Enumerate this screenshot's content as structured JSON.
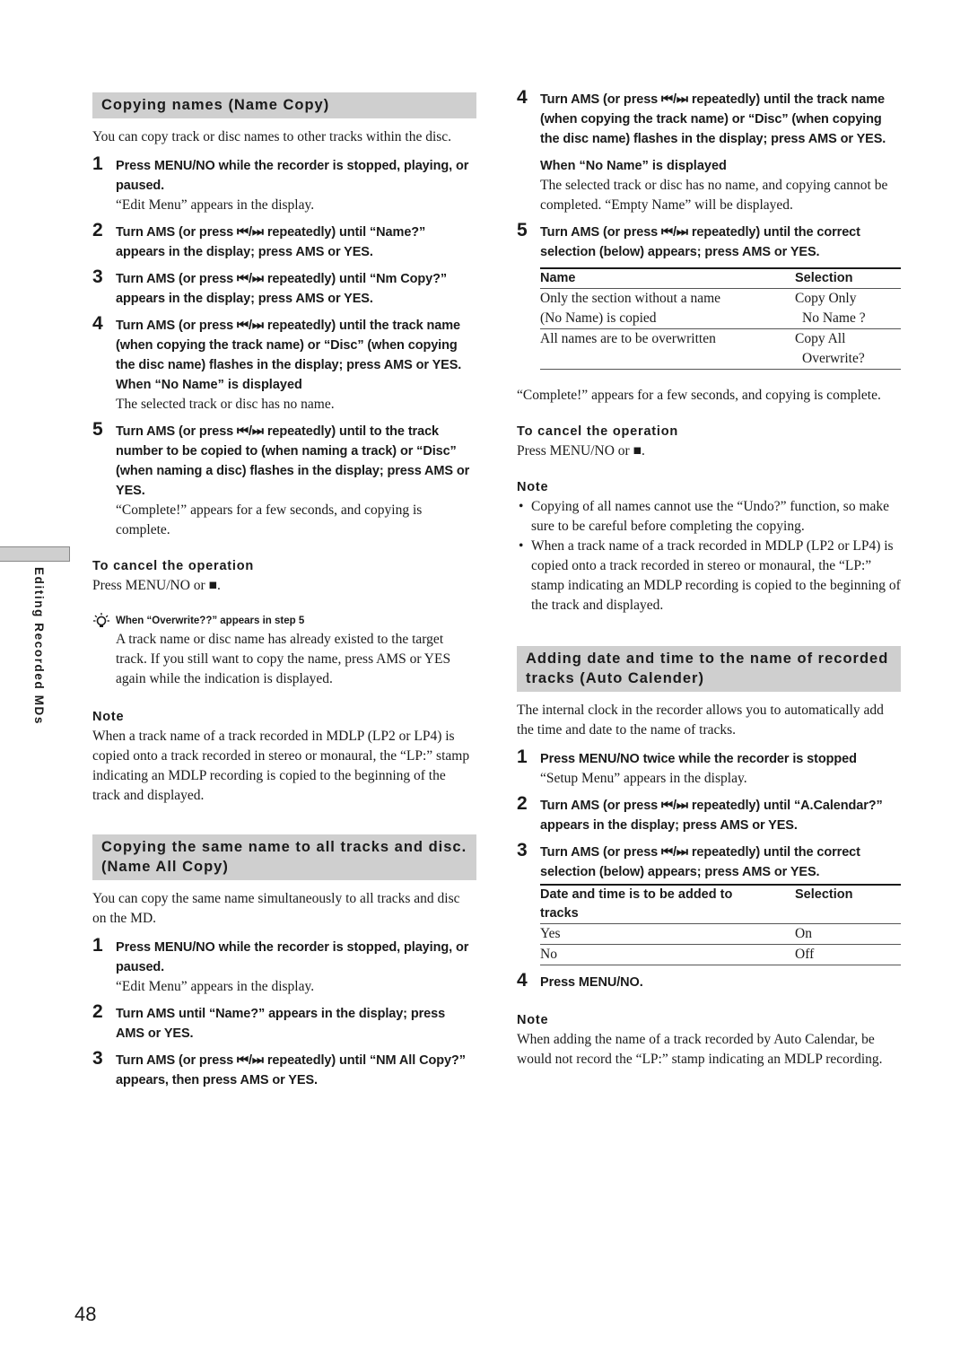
{
  "side_tab": {
    "label": "Editing Recorded MDs"
  },
  "page_number": "48",
  "left": {
    "section1": {
      "heading": "Copying names (Name Copy)",
      "intro": "You can copy track or disc names to other tracks within the disc.",
      "steps": [
        {
          "num": "1",
          "text": "Press MENU/NO while the recorder is stopped, playing, or paused.",
          "result": "“Edit Menu” appears in the display."
        },
        {
          "num": "2",
          "text": "Turn AMS (or press ⏮/⏭ repeatedly) until “Name?” appears in the display; press AMS or YES."
        },
        {
          "num": "3",
          "text": "Turn AMS (or press ⏮/⏭ repeatedly) until “Nm Copy?” appears in the display; press AMS or YES."
        },
        {
          "num": "4",
          "text": "Turn AMS (or press ⏮/⏭ repeatedly) until the track name (when copying the track name) or “Disc” (when copying the disc name) flashes in the display; press AMS or YES.",
          "sub_heading": "When “No Name” is displayed",
          "sub_text": "The selected track or disc has no name."
        },
        {
          "num": "5",
          "text": "Turn AMS (or press ⏮/⏭ repeatedly) until to the track number to be copied to (when naming a track)  or “Disc”  (when naming a disc) flashes in the display; press AMS or YES.",
          "result": "“Complete!” appears for a few seconds, and copying is complete."
        }
      ],
      "cancel_heading": "To cancel the operation",
      "cancel_text": "Press MENU/NO or ■.",
      "tip": {
        "icon": "lightbulb-icon",
        "title": "When “Overwrite??” appears in step 5",
        "text": "A track name or disc name has already existed to the target track. If you still want to copy the name, press AMS or YES again while the indication is displayed."
      },
      "note_heading": "Note",
      "note_text": "When a track name of a track recorded in MDLP (LP2 or LP4) is copied onto a track recorded in stereo or monaural, the “LP:” stamp indicating an MDLP recording is copied to the beginning of the track and displayed."
    },
    "section2": {
      "heading": "Copying the same name to all tracks and disc. (Name All Copy)",
      "intro": "You can copy the same name simultaneously to all tracks and disc on the MD.",
      "steps": [
        {
          "num": "1",
          "text": "Press MENU/NO while the recorder is stopped, playing, or paused.",
          "result": "“Edit Menu” appears in the display."
        },
        {
          "num": "2",
          "text": "Turn AMS until “Name?” appears in the display; press AMS or YES."
        },
        {
          "num": "3",
          "text": "Turn AMS (or press ⏮/⏭ repeatedly) until “NM All Copy?” appears, then press AMS or YES."
        }
      ]
    }
  },
  "right": {
    "continued_steps": [
      {
        "num": "4",
        "text": "Turn AMS (or press ⏮/⏭ repeatedly) until the track name (when copying the track name) or “Disc” (when copying the disc name) flashes in the display; press AMS or YES.",
        "sub_heading": "When “No Name” is displayed",
        "sub_text": "The selected track or disc has no name, and copying cannot be completed. “Empty Name” will be displayed."
      },
      {
        "num": "5",
        "text": "Turn AMS (or press ⏮/⏭ repeatedly) until the correct selection (below) appears; press AMS or YES."
      }
    ],
    "table1": {
      "headers": [
        "Name",
        "Selection"
      ],
      "rows": [
        {
          "name_lines": [
            "Only the section without a name",
            "(No Name) is copied"
          ],
          "selection_lines": [
            "Copy Only",
            "No Name ?"
          ]
        },
        {
          "name_lines": [
            "All names are to be overwritten",
            ""
          ],
          "selection_lines": [
            "Copy All",
            "Overwrite?"
          ]
        }
      ]
    },
    "complete_text": "“Complete!” appears for a few seconds, and copying is complete.",
    "cancel_heading": "To cancel the operation",
    "cancel_text": "Press MENU/NO or ■.",
    "note_heading": "Note",
    "notes": [
      "Copying of all names cannot use the “Undo?” function, so make sure to be careful before completing the copying.",
      "When a track name of a track recorded in MDLP (LP2 or LP4) is copied onto a track recorded in stereo or monaural, the “LP:” stamp indicating an MDLP recording is copied to the beginning of the track and displayed."
    ],
    "section3": {
      "heading": "Adding date and time to the name of recorded tracks (Auto Calender)",
      "intro": "The internal clock in the recorder allows you to automatically add the time and date to the name of tracks.",
      "steps": [
        {
          "num": "1",
          "text": "Press MENU/NO twice while the recorder is stopped",
          "result": "“Setup Menu” appears in the display."
        },
        {
          "num": "2",
          "text": "Turn AMS (or press ⏮/⏭ repeatedly) until “A.Calendar?” appears in the display; press AMS or YES."
        },
        {
          "num": "3",
          "text": "Turn AMS (or press ⏮/⏭ repeatedly) until the correct selection (below) appears; press AMS or YES."
        }
      ],
      "table2": {
        "headers": [
          "Date and time is to be added to tracks",
          "Selection"
        ],
        "rows": [
          {
            "name": "Yes",
            "selection": "On"
          },
          {
            "name": "No",
            "selection": "Off"
          }
        ]
      },
      "step4": {
        "num": "4",
        "text": "Press MENU/NO."
      },
      "note_heading": "Note",
      "note_text": "When adding the name of a track recorded by Auto Calendar, be would not record the “LP:” stamp indicating an MDLP recording."
    }
  }
}
